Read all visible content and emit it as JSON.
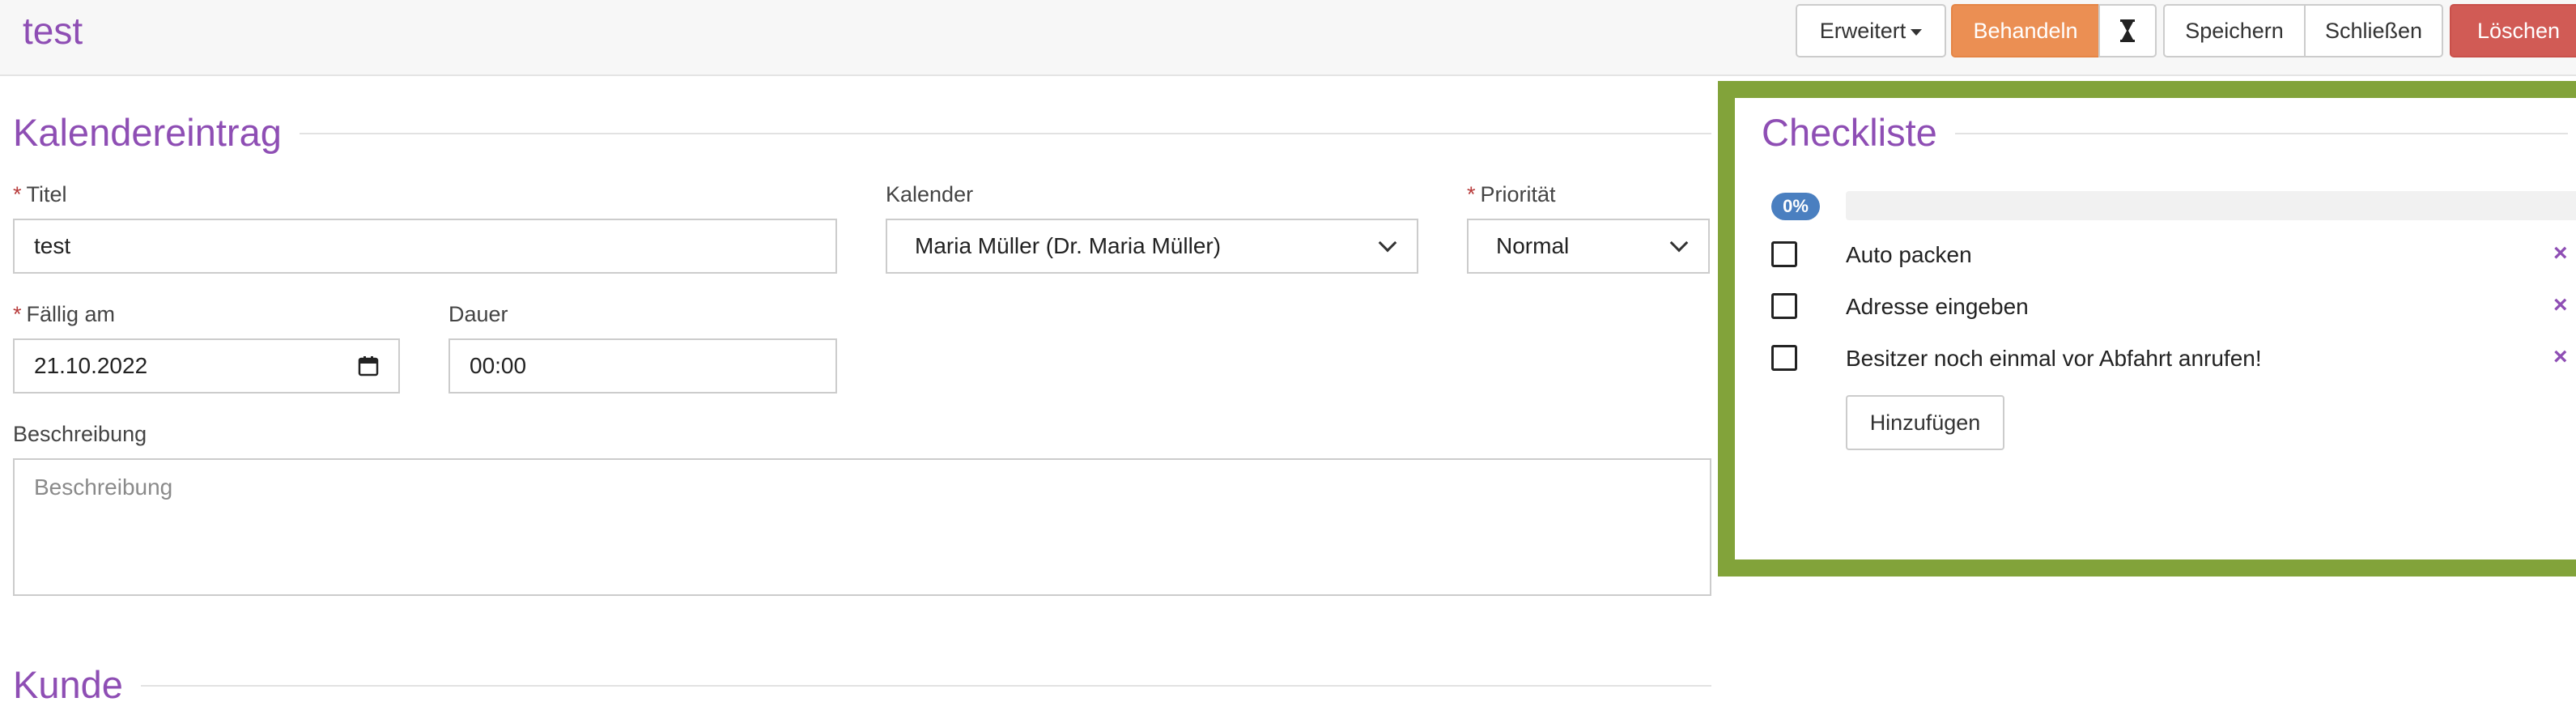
{
  "header": {
    "title": "test"
  },
  "toolbar": {
    "erweitert_label": "Erweitert",
    "behandeln_label": "Behandeln",
    "hourglass_icon": "hourglass-icon",
    "speichern_label": "Speichern",
    "schliessen_label": "Schließen",
    "loeschen_label": "Löschen"
  },
  "kalendereintrag": {
    "section_title": "Kalendereintrag",
    "required_marker": "*",
    "titel": {
      "label": "Titel",
      "value": "test"
    },
    "kalender": {
      "label": "Kalender",
      "value": "Maria Müller (Dr. Maria Müller)"
    },
    "prioritaet": {
      "label": "Priorität",
      "value": "Normal"
    },
    "faellig": {
      "label": "Fällig am",
      "value": "21.10.2022"
    },
    "dauer": {
      "label": "Dauer",
      "value": "00:00"
    },
    "beschreibung": {
      "label": "Beschreibung",
      "placeholder": "Beschreibung",
      "value": ""
    }
  },
  "kunde": {
    "section_title": "Kunde"
  },
  "checkliste": {
    "section_title": "Checkliste",
    "progress_label": "0%",
    "progress_percent": 0,
    "items": [
      {
        "label": "Auto packen",
        "checked": false
      },
      {
        "label": "Adresse eingeben",
        "checked": false
      },
      {
        "label": "Besitzer noch einmal vor Abfahrt anrufen!",
        "checked": false
      }
    ],
    "remove_symbol": "×",
    "add_label": "Hinzufügen"
  },
  "colors": {
    "accent": "#8e4eb4",
    "behandeln": "#eb8f53",
    "loeschen": "#d15b55",
    "highlight_border": "#82a33a",
    "badge": "#4a7fc0"
  }
}
